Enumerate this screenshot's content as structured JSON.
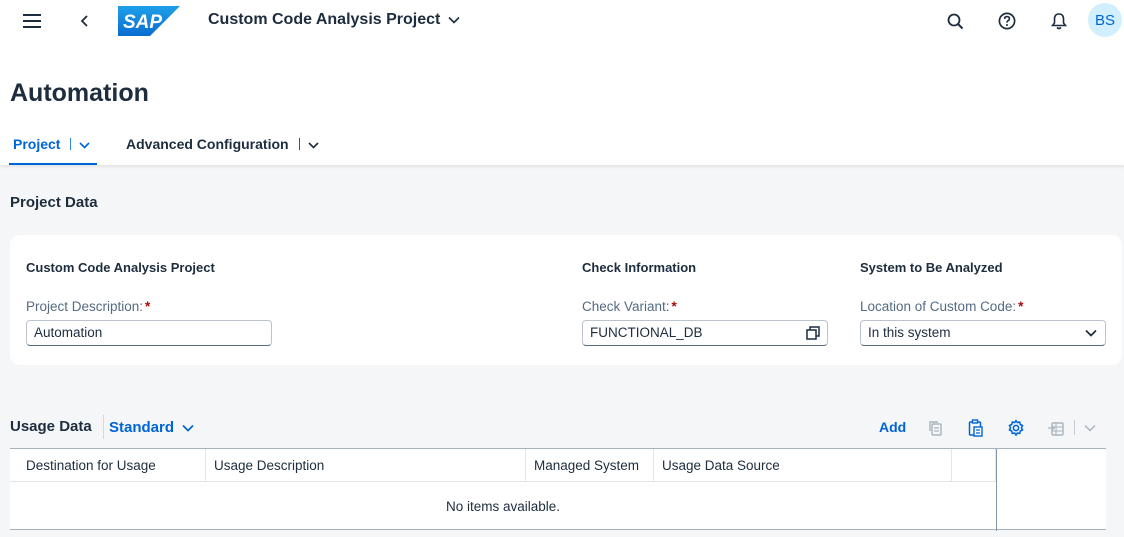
{
  "shell": {
    "app_title": "Custom Code Analysis Project",
    "logo_text": "SAP",
    "avatar_initials": "BS",
    "icons": [
      "menu-icon",
      "back-icon",
      "search-icon",
      "help-icon",
      "bell-icon"
    ]
  },
  "header": {
    "title": "Automation",
    "tabs": [
      {
        "label": "Project",
        "selected": true
      },
      {
        "label": "Advanced Configuration",
        "selected": false
      }
    ]
  },
  "project_data": {
    "section_title": "Project Data",
    "groups": [
      {
        "title": "Custom Code Analysis Project",
        "field_label": "Project Description:",
        "value": "Automation"
      },
      {
        "title": "Check Information",
        "field_label": "Check Variant:",
        "value": "FUNCTIONAL_DB"
      },
      {
        "title": "System to Be Analyzed",
        "field_label": "Location of Custom Code:",
        "value": "In this system"
      }
    ],
    "required_marker": "*"
  },
  "usage_data": {
    "title": "Usage Data",
    "variant": "Standard",
    "toolbar": {
      "add_label": "Add"
    },
    "columns": [
      "Destination for Usage",
      "Usage Description",
      "Managed System",
      "Usage Data Source"
    ],
    "empty_text": "No items available."
  },
  "colors": {
    "brand": "#0064d9",
    "text": "#1d2d3e",
    "required": "#aa0808",
    "background": "#f5f6f7"
  }
}
